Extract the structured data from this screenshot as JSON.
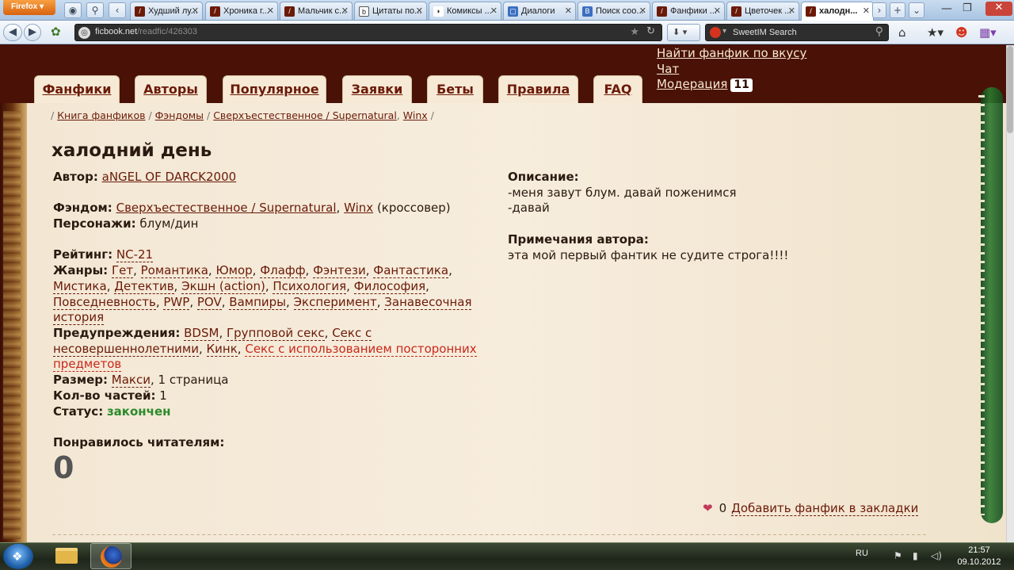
{
  "browser": {
    "firefox_label": "Firefox ▾",
    "tabs": [
      {
        "title": "Худший лу..."
      },
      {
        "title": "Хроника г..."
      },
      {
        "title": "Мальчик с..."
      },
      {
        "title": "Цитаты по..."
      },
      {
        "title": "Комиксы ..."
      },
      {
        "title": "Диалоги"
      },
      {
        "title": "Поиск соо..."
      },
      {
        "title": "Фанфики ..."
      },
      {
        "title": "Цветочек ..."
      },
      {
        "title": "халодн..."
      }
    ],
    "url_host": "ficbook.net",
    "url_path": "/readfic/426303",
    "search_engine": "SweetIM Search"
  },
  "site": {
    "nav": [
      {
        "label": "Фанфики"
      },
      {
        "label": "Авторы"
      },
      {
        "label": "Популярное"
      },
      {
        "label": "Заявки"
      },
      {
        "label": "Беты"
      },
      {
        "label": "Правила"
      },
      {
        "label": "FAQ"
      }
    ],
    "right_links": {
      "find": "Найти фанфик по вкусу",
      "chat": "Чат",
      "moderation": "Модерация",
      "moderation_count": "11"
    }
  },
  "breadcrumbs": {
    "book": "Книга фанфиков",
    "fandoms": "Фэндомы",
    "supernatural": "Сверхъестественное / Supernatural",
    "winx": "Winx"
  },
  "fic": {
    "title": "халодний день",
    "author_label": "Автор:",
    "author": "aNGEL OF DARCK2000",
    "fandom_label": "Фэндом:",
    "fandom_1": "Сверхъестественное / Supernatural",
    "fandom_2": "Winx",
    "fandom_suffix": "(кроссовер)",
    "characters_label": "Персонажи:",
    "characters": "блум/дин",
    "rating_label": "Рейтинг:",
    "rating": "NC-21",
    "genres_label": "Жанры:",
    "genres": [
      "Гет",
      "Романтика",
      "Юмор",
      "Флафф",
      "Фэнтези",
      "Фантастика",
      "Мистика",
      "Детектив",
      "Экшн (action)",
      "Психология",
      "Философия",
      "Повседневность",
      "PWP",
      "POV",
      "Вампиры",
      "Эксперимент",
      "Занавесочная",
      "история"
    ],
    "warnings_label": "Предупреждения:",
    "warnings": [
      "BDSM",
      "Групповой секс",
      "Секс с",
      "несовершеннолетними",
      "Кинк",
      "Секс с использованием посторонних",
      "предметов"
    ],
    "size_label": "Размер:",
    "size_value": "Макси",
    "size_pages": ", 1 страница",
    "parts_label": "Кол-во частей:",
    "parts": "1",
    "status_label": "Статус:",
    "status": "закончен",
    "likes_label": "Понравилось читателям:",
    "likes": "0",
    "description_label": "Описание:",
    "description_line1": "-меня завут блум. давай поженимся",
    "description_line2": "-давай",
    "notes_label": "Примечания автора:",
    "notes": "эта мой первый фантик не судите строга!!!!",
    "bookmarks_count": "0",
    "bookmark_label": "Добавить фанфик в закладки"
  },
  "taskbar": {
    "lang": "RU",
    "time": "21:57",
    "date": "09.10.2012"
  }
}
